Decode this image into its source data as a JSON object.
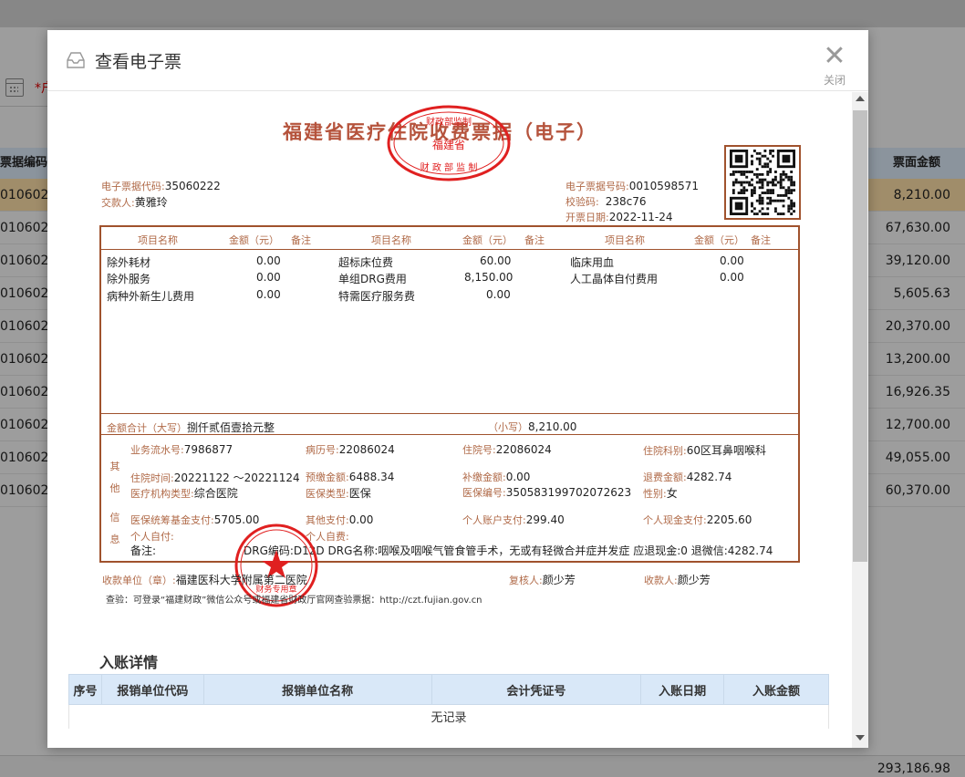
{
  "background": {
    "filter_label": "*户",
    "header_left": "票据编码",
    "header_right": "票面金额",
    "rows": [
      {
        "code": "010602",
        "amount": "8,210.00",
        "selected": true
      },
      {
        "code": "010602",
        "amount": "67,630.00"
      },
      {
        "code": "010602",
        "amount": "39,120.00"
      },
      {
        "code": "010602",
        "amount": "5,605.63"
      },
      {
        "code": "010602",
        "amount": "20,370.00"
      },
      {
        "code": "010602",
        "amount": "13,200.00"
      },
      {
        "code": "010602",
        "amount": "16,926.35"
      },
      {
        "code": "010602",
        "amount": "12,700.00"
      },
      {
        "code": "010602",
        "amount": "49,055.00"
      },
      {
        "code": "010602",
        "amount": "60,370.00"
      }
    ],
    "total": "293,186.98"
  },
  "modal": {
    "title": "查看电子票",
    "close_label": "关闭"
  },
  "invoice": {
    "title": "福建省医疗住院收费票据（电子）",
    "seal_top": {
      "line1": "财政部监制",
      "line2": "福建省",
      "line3": "财 政 部 监 制"
    },
    "code_label": "电子票据代码:",
    "code_value": "35060222",
    "payer_label": "交款人:",
    "payer_value": "黄雅玲",
    "number_label": "电子票据号码:",
    "number_value": "0010598571",
    "check_label": "校验码:",
    "check_value": "238c76",
    "date_label": "开票日期:",
    "date_value": "2022-11-24",
    "col_item": "项目名称",
    "col_amount": "金额（元）",
    "col_note": "备注",
    "items": [
      {
        "name": "除外耗材",
        "amount": "0.00"
      },
      {
        "name": "除外服务",
        "amount": "0.00"
      },
      {
        "name": "病种外新生儿费用",
        "amount": "0.00"
      },
      {
        "name": "超标床位费",
        "amount": "60.00"
      },
      {
        "name": "单组DRG费用",
        "amount": "8,150.00"
      },
      {
        "name": "特需医疗服务费",
        "amount": "0.00"
      },
      {
        "name": "临床用血",
        "amount": "0.00"
      },
      {
        "name": "人工晶体自付费用",
        "amount": "0.00"
      }
    ],
    "total_upper_label": "金额合计（大写）",
    "total_upper_value": "捌仟贰佰壹拾元整",
    "total_lower_label": "（小写）",
    "total_lower_value": "8,210.00",
    "other_info_label": [
      "其",
      "他",
      "信",
      "息"
    ],
    "serial_label": "业务流水号:",
    "serial_value": "7986877",
    "record_label": "病历号:",
    "record_value": "22086024",
    "inpatient_label": "住院号:",
    "inpatient_value": "22086024",
    "dept_label": "住院科别:",
    "dept_value": "60区耳鼻咽喉科",
    "period_label": "住院时间:",
    "period_value": "20221122 ～20221124",
    "prepaid_label": "预缴金额:",
    "prepaid_value": "6488.34",
    "supplement_label": "补缴金额:",
    "supplement_value": "0.00",
    "refund_label": "退费金额:",
    "refund_value": "4282.74",
    "org_type_label": "医疗机构类型:",
    "org_type_value": "综合医院",
    "ins_type_label": "医保类型:",
    "ins_type_value": "医保",
    "ins_no_label": "医保编号:",
    "ins_no_value": "350583199702072623",
    "gender_label": "性别:",
    "gender_value": "女",
    "fund_label": "医保统筹基金支付:",
    "fund_value": "5705.00",
    "other_pay_label": "其他支付:",
    "other_pay_value": "0.00",
    "account_label": "个人账户支付:",
    "account_value": "299.40",
    "cash_label": "个人现金支付:",
    "cash_value": "2205.60",
    "self_pay_label": "个人自付:",
    "self_fee_label": "个人自费:",
    "remark_label": "备注:",
    "remark_value": "DRG编码:D12D DRG名称:咽喉及咽喉气管食管手术，无或有轻微合并症并发症 应退现金:0 退微信:4282.74",
    "payee_unit_label": "收款单位（章）:",
    "payee_unit_value": "福建医科大学附属第二医院",
    "reviewer_label": "复核人:",
    "reviewer_value": "颜少芳",
    "payee_label": "收款人:",
    "payee_value": "颜少芳",
    "verify_text": "查验：可登录“福建财政”微信公众号或福建省财政厅官网查验票据：http://czt.fujian.gov.cn",
    "seal_bottom": {
      "text": "财务专用章"
    }
  },
  "details": {
    "section_title": "入账详情",
    "columns": [
      "序号",
      "报销单位代码",
      "报销单位名称",
      "会计凭证号",
      "入账日期",
      "入账金额"
    ],
    "empty_text": "无记录"
  },
  "colors": {
    "invoice_brown": "#a0522d",
    "seal_red": "#e02020",
    "selected_row": "#f6d9a3",
    "table_header": "#d9e8f8"
  }
}
